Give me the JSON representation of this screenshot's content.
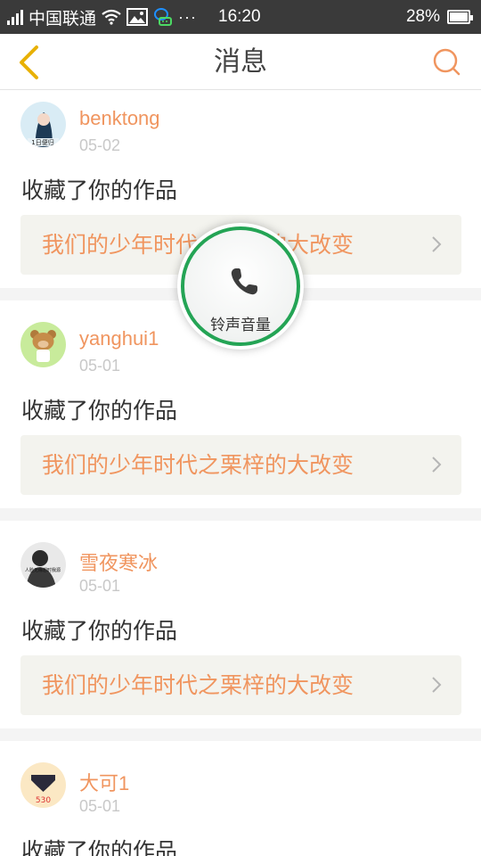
{
  "status_bar": {
    "carrier": "中国联通",
    "time": "16:20",
    "battery_percent": "28%",
    "signal_icon": "signal-icon",
    "wifi_icon": "wifi-icon",
    "notification_icons": [
      "image-icon",
      "wechat-icon"
    ],
    "more_icon": "ellipsis-icon"
  },
  "header": {
    "title": "消息",
    "back_icon": "back-chevron-icon",
    "search_icon": "search-icon",
    "accent_color": "#f0955f",
    "back_color": "#e8b100"
  },
  "messages": [
    {
      "username": "benktong",
      "date": "05-02",
      "action": "收藏了你的作品",
      "work_title": "我们的少年时代之栗梓的大改变",
      "avatar_text": "1日便归"
    },
    {
      "username": "yanghui1",
      "date": "05-01",
      "action": "收藏了你的作品",
      "work_title": "我们的少年时代之栗梓的大改变",
      "avatar_text": ""
    },
    {
      "username": "雪夜寒冰",
      "date": "05-01",
      "action": "收藏了你的作品",
      "work_title": "我们的少年时代之栗梓的大改变",
      "avatar_text": "人脸无缘想时我源"
    },
    {
      "username": "大可1",
      "date": "05-01",
      "action": "收藏了你的作品",
      "work_title": "",
      "avatar_text": "530"
    }
  ],
  "floating_button": {
    "label": "铃声音量",
    "icon": "phone-icon",
    "ring_color": "#24a455"
  }
}
